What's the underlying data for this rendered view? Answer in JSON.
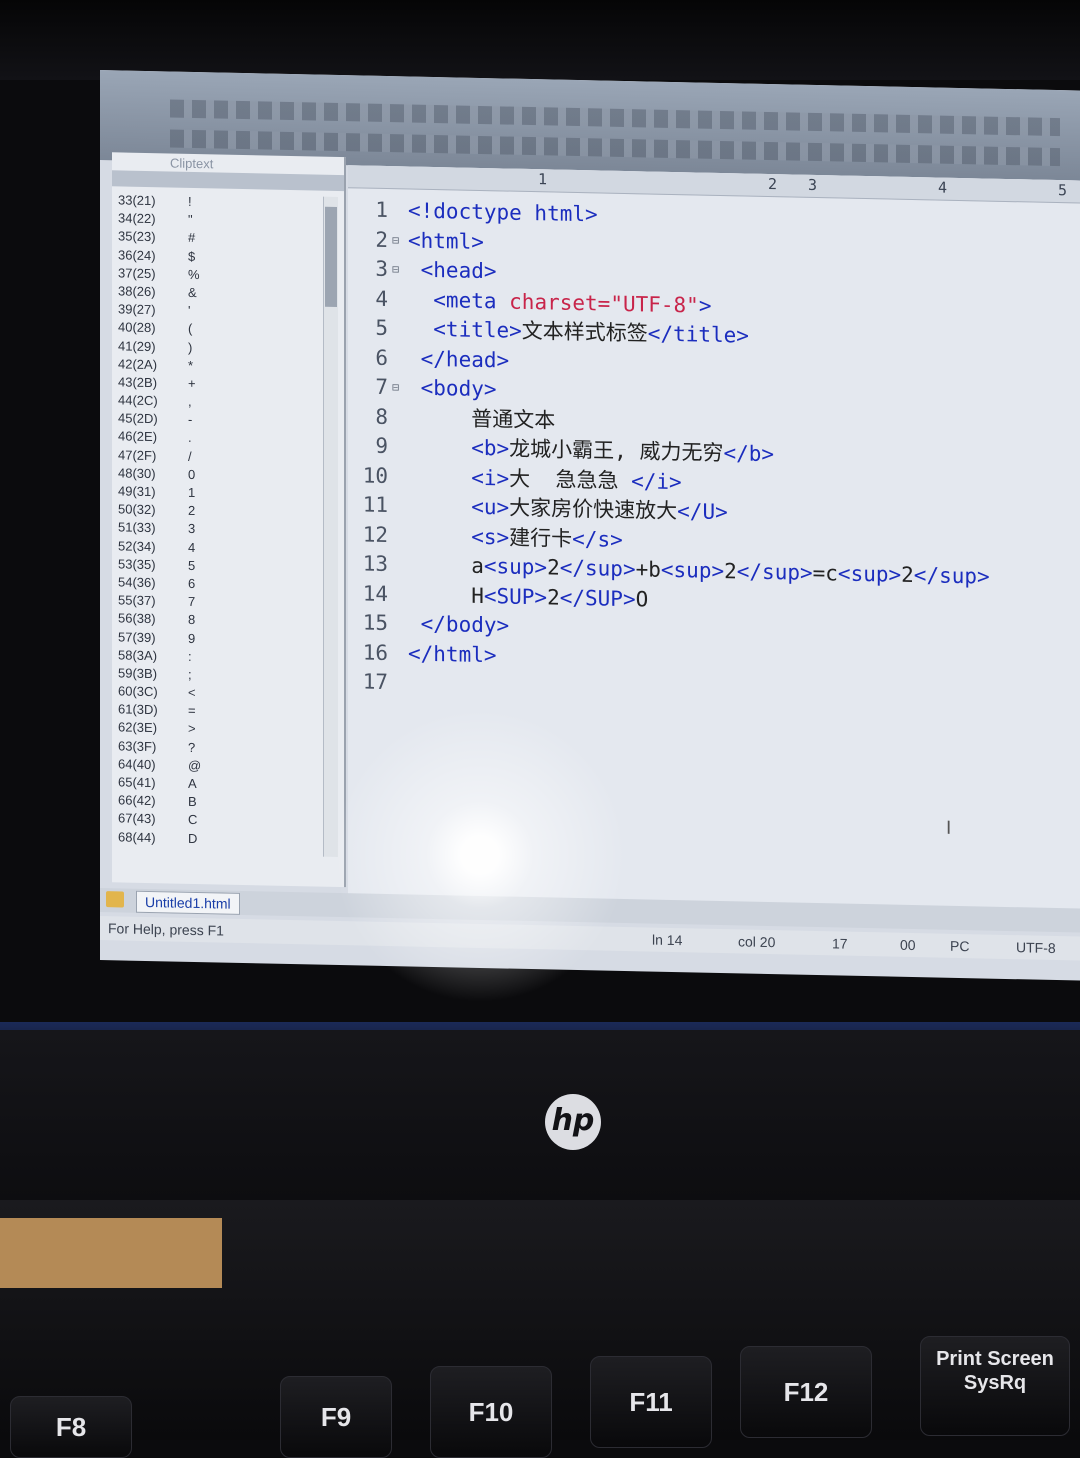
{
  "clip_panel": {
    "tab_label": "Cliptext",
    "items": [
      {
        "code": "33(21)",
        "ch": "!"
      },
      {
        "code": "34(22)",
        "ch": "\""
      },
      {
        "code": "35(23)",
        "ch": "#"
      },
      {
        "code": "36(24)",
        "ch": "$"
      },
      {
        "code": "37(25)",
        "ch": "%"
      },
      {
        "code": "38(26)",
        "ch": "&"
      },
      {
        "code": "39(27)",
        "ch": "'"
      },
      {
        "code": "40(28)",
        "ch": "("
      },
      {
        "code": "41(29)",
        "ch": ")"
      },
      {
        "code": "42(2A)",
        "ch": "*"
      },
      {
        "code": "43(2B)",
        "ch": "+"
      },
      {
        "code": "44(2C)",
        "ch": ","
      },
      {
        "code": "45(2D)",
        "ch": "-"
      },
      {
        "code": "46(2E)",
        "ch": "."
      },
      {
        "code": "47(2F)",
        "ch": "/"
      },
      {
        "code": "48(30)",
        "ch": "0"
      },
      {
        "code": "49(31)",
        "ch": "1"
      },
      {
        "code": "50(32)",
        "ch": "2"
      },
      {
        "code": "51(33)",
        "ch": "3"
      },
      {
        "code": "52(34)",
        "ch": "4"
      },
      {
        "code": "53(35)",
        "ch": "5"
      },
      {
        "code": "54(36)",
        "ch": "6"
      },
      {
        "code": "55(37)",
        "ch": "7"
      },
      {
        "code": "56(38)",
        "ch": "8"
      },
      {
        "code": "57(39)",
        "ch": "9"
      },
      {
        "code": "58(3A)",
        "ch": ":"
      },
      {
        "code": "59(3B)",
        "ch": ";"
      },
      {
        "code": "60(3C)",
        "ch": "<"
      },
      {
        "code": "61(3D)",
        "ch": "="
      },
      {
        "code": "62(3E)",
        "ch": ">"
      },
      {
        "code": "63(3F)",
        "ch": "?"
      },
      {
        "code": "64(40)",
        "ch": "@"
      },
      {
        "code": "65(41)",
        "ch": "A"
      },
      {
        "code": "66(42)",
        "ch": "B"
      },
      {
        "code": "67(43)",
        "ch": "C"
      },
      {
        "code": "68(44)",
        "ch": "D"
      }
    ]
  },
  "ruler": {
    "marks": [
      "1",
      "2",
      "3",
      "4",
      "5"
    ]
  },
  "code_lines": [
    {
      "n": "1",
      "segs": [
        [
          "tag",
          "<!doctype html>"
        ]
      ]
    },
    {
      "n": "2",
      "fold": "⊟",
      "segs": [
        [
          "tag",
          "<html>"
        ]
      ]
    },
    {
      "n": "3",
      "fold": "⊟",
      "segs": [
        [
          "tag",
          " <head>"
        ]
      ]
    },
    {
      "n": "4",
      "segs": [
        [
          "tag",
          "  <meta "
        ],
        [
          "attr",
          "charset="
        ],
        [
          "val",
          "\"UTF-8\""
        ],
        [
          "tag",
          ">"
        ]
      ]
    },
    {
      "n": "5",
      "segs": [
        [
          "tag",
          "  <title>"
        ],
        [
          "plain",
          "文本样式标签"
        ],
        [
          "tag",
          "</title>"
        ]
      ]
    },
    {
      "n": "6",
      "segs": [
        [
          "tag",
          " </head>"
        ]
      ]
    },
    {
      "n": "7",
      "fold": "⊟",
      "segs": [
        [
          "tag",
          " <body>"
        ]
      ]
    },
    {
      "n": "8",
      "segs": [
        [
          "plain",
          "     普通文本"
        ]
      ]
    },
    {
      "n": "9",
      "segs": [
        [
          "tag",
          "     <b>"
        ],
        [
          "plain",
          "龙城小霸王, 威力无穷"
        ],
        [
          "tag",
          "</b>"
        ]
      ]
    },
    {
      "n": "10",
      "segs": [
        [
          "tag",
          "     <i>"
        ],
        [
          "plain",
          "大  急急急 "
        ],
        [
          "tag",
          "</i>"
        ]
      ]
    },
    {
      "n": "11",
      "segs": [
        [
          "tag",
          "     <u>"
        ],
        [
          "plain",
          "大家房价快速放大"
        ],
        [
          "tag",
          "</U>"
        ]
      ]
    },
    {
      "n": "12",
      "segs": [
        [
          "tag",
          "     <s>"
        ],
        [
          "plain",
          "建行卡"
        ],
        [
          "tag",
          "</s>"
        ]
      ]
    },
    {
      "n": "13",
      "segs": [
        [
          "plain",
          "     a"
        ],
        [
          "tag",
          "<sup>"
        ],
        [
          "plain",
          "2"
        ],
        [
          "tag",
          "</sup>"
        ],
        [
          "plain",
          "+b"
        ],
        [
          "tag",
          "<sup>"
        ],
        [
          "plain",
          "2"
        ],
        [
          "tag",
          "</sup>"
        ],
        [
          "plain",
          "=c"
        ],
        [
          "tag",
          "<sup>"
        ],
        [
          "plain",
          "2"
        ],
        [
          "tag",
          "</sup>"
        ]
      ]
    },
    {
      "n": "14",
      "segs": [
        [
          "plain",
          "     H"
        ],
        [
          "tag",
          "<SUP>"
        ],
        [
          "plain",
          "2"
        ],
        [
          "tag",
          "</SUP>"
        ],
        [
          "plain",
          "O"
        ]
      ]
    },
    {
      "n": "15",
      "segs": [
        [
          "tag",
          " </body>"
        ]
      ]
    },
    {
      "n": "16",
      "segs": [
        [
          "tag",
          "</html>"
        ]
      ]
    },
    {
      "n": "17",
      "segs": []
    }
  ],
  "doc_tab": {
    "label": "Untitled1.html"
  },
  "status": {
    "help": "For Help, press F1",
    "line": "ln 14",
    "col": "col 20",
    "count": "17",
    "code": "00",
    "mode": "PC",
    "encoding": "UTF-8"
  },
  "brand": "hp",
  "keys": {
    "f8": "F8",
    "f9": "F9",
    "f10": "F10",
    "f11": "F11",
    "f12": "F12",
    "prtsc": "Print Screen SysRq"
  }
}
